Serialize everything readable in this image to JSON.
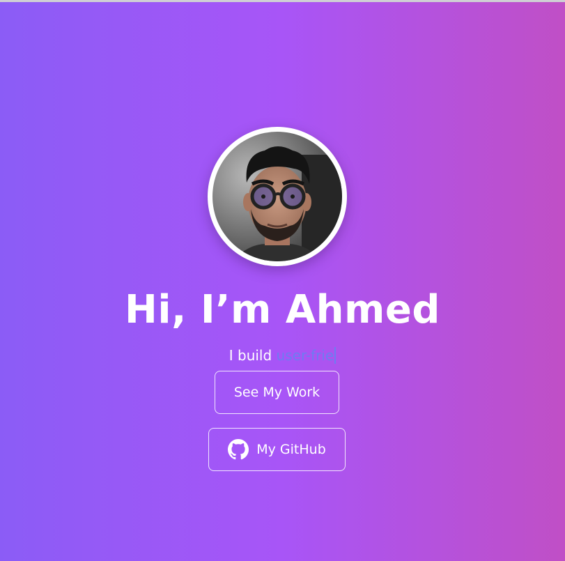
{
  "hero": {
    "greeting": "Hi, I’m Ahmed",
    "tagline_prefix": "I build ",
    "tagline_typed": "user-frie",
    "avatar_alt": "Ahmed"
  },
  "buttons": {
    "work_label": "See My Work",
    "github_label": "My GitHub",
    "github_icon": "github-icon"
  },
  "colors": {
    "gradient_start": "#8b5cf6",
    "gradient_mid": "#a855f7",
    "gradient_end": "#c04fc6",
    "typed_text": "#6d7cf2"
  }
}
